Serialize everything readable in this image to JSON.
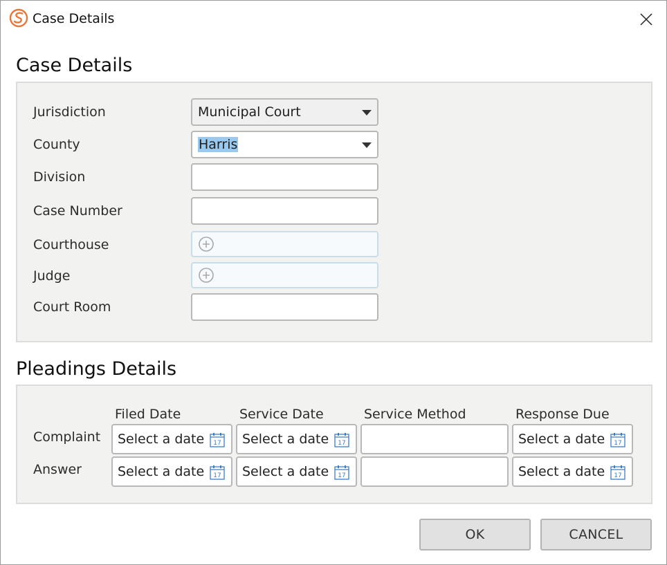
{
  "window": {
    "title": "Case Details",
    "brand_color": "#e8773a"
  },
  "case_details": {
    "heading": "Case Details",
    "fields": {
      "jurisdiction": {
        "label": "Jurisdiction",
        "value": "Municipal Court"
      },
      "county": {
        "label": "County",
        "value": "Harris"
      },
      "division": {
        "label": "Division",
        "value": ""
      },
      "case_number": {
        "label": "Case Number",
        "value": ""
      },
      "courthouse": {
        "label": "Courthouse",
        "icon": "plus-circle-icon"
      },
      "judge": {
        "label": "Judge",
        "icon": "plus-circle-icon"
      },
      "court_room": {
        "label": "Court Room",
        "value": ""
      }
    }
  },
  "pleadings": {
    "heading": "Pleadings Details",
    "columns": [
      "Filed Date",
      "Service Date",
      "Service Method",
      "Response Due"
    ],
    "rows": [
      {
        "label": "Complaint",
        "filed_date": "Select a date",
        "service_date": "Select a date",
        "service_method": "",
        "response_due": "Select a date"
      },
      {
        "label": "Answer",
        "filed_date": "Select a date",
        "service_date": "Select a date",
        "service_method": "",
        "response_due": "Select a date"
      }
    ],
    "calendar_icon_text": "17"
  },
  "buttons": {
    "ok": "OK",
    "cancel": "CANCEL"
  }
}
